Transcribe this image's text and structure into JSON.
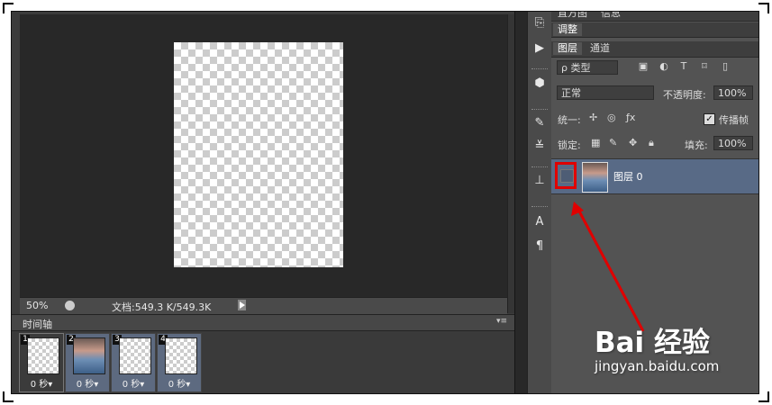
{
  "status_bar": {
    "zoom": "50%",
    "doc_info": "文档:549.3 K/549.3K"
  },
  "timeline": {
    "title": "时间轴",
    "menu": "▾≡",
    "frames": [
      {
        "num": "1",
        "duration": "0 秒▾",
        "content": "transparent"
      },
      {
        "num": "2",
        "duration": "0 秒▾",
        "content": "photo"
      },
      {
        "num": "3",
        "duration": "0 秒▾",
        "content": "transparent"
      },
      {
        "num": "4",
        "duration": "0 秒▾",
        "content": "transparent"
      }
    ]
  },
  "panel": {
    "top_tabs": [
      "直方图",
      "信息"
    ],
    "adjust_tab": "调整",
    "layer_tabs": [
      "图层",
      "通道"
    ],
    "filter_label": "ρ 类型",
    "blend_mode": "正常",
    "opacity_label": "不透明度:",
    "opacity_value": "100%",
    "unify_label": "统一:",
    "propagate_label": "传播帧",
    "lock_label": "锁定:",
    "fill_label": "填充:",
    "fill_value": "100%",
    "layer_name": "图层 0"
  },
  "watermark": {
    "brand": "Bai 经验",
    "url": "jingyan.baidu.com"
  },
  "colors": {
    "highlight": "#e00000",
    "selected_layer": "#586a86"
  }
}
